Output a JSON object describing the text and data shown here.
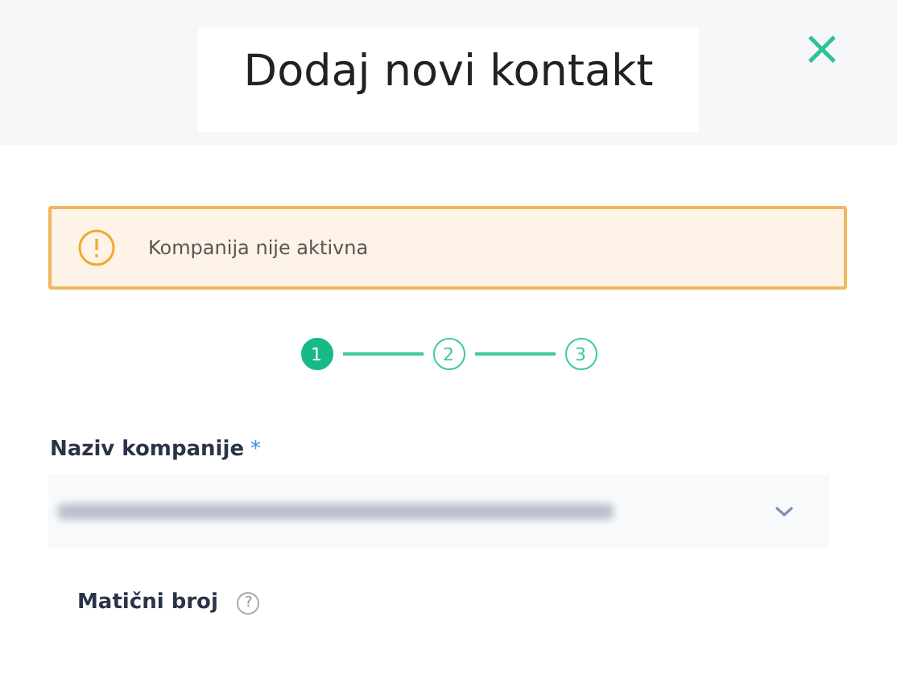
{
  "dialog": {
    "title": "Dodaj novi kontakt",
    "close": "×"
  },
  "alert": {
    "text": "Kompanija nije aktivna"
  },
  "steps": [
    {
      "label": "1",
      "selected": true
    },
    {
      "label": "2",
      "selected": false
    },
    {
      "label": "3",
      "selected": false
    }
  ],
  "company_field": {
    "label": "Naziv kompanije",
    "required_mark": "*"
  },
  "registration_field": {
    "label": "Matični broj",
    "help": "?"
  }
}
